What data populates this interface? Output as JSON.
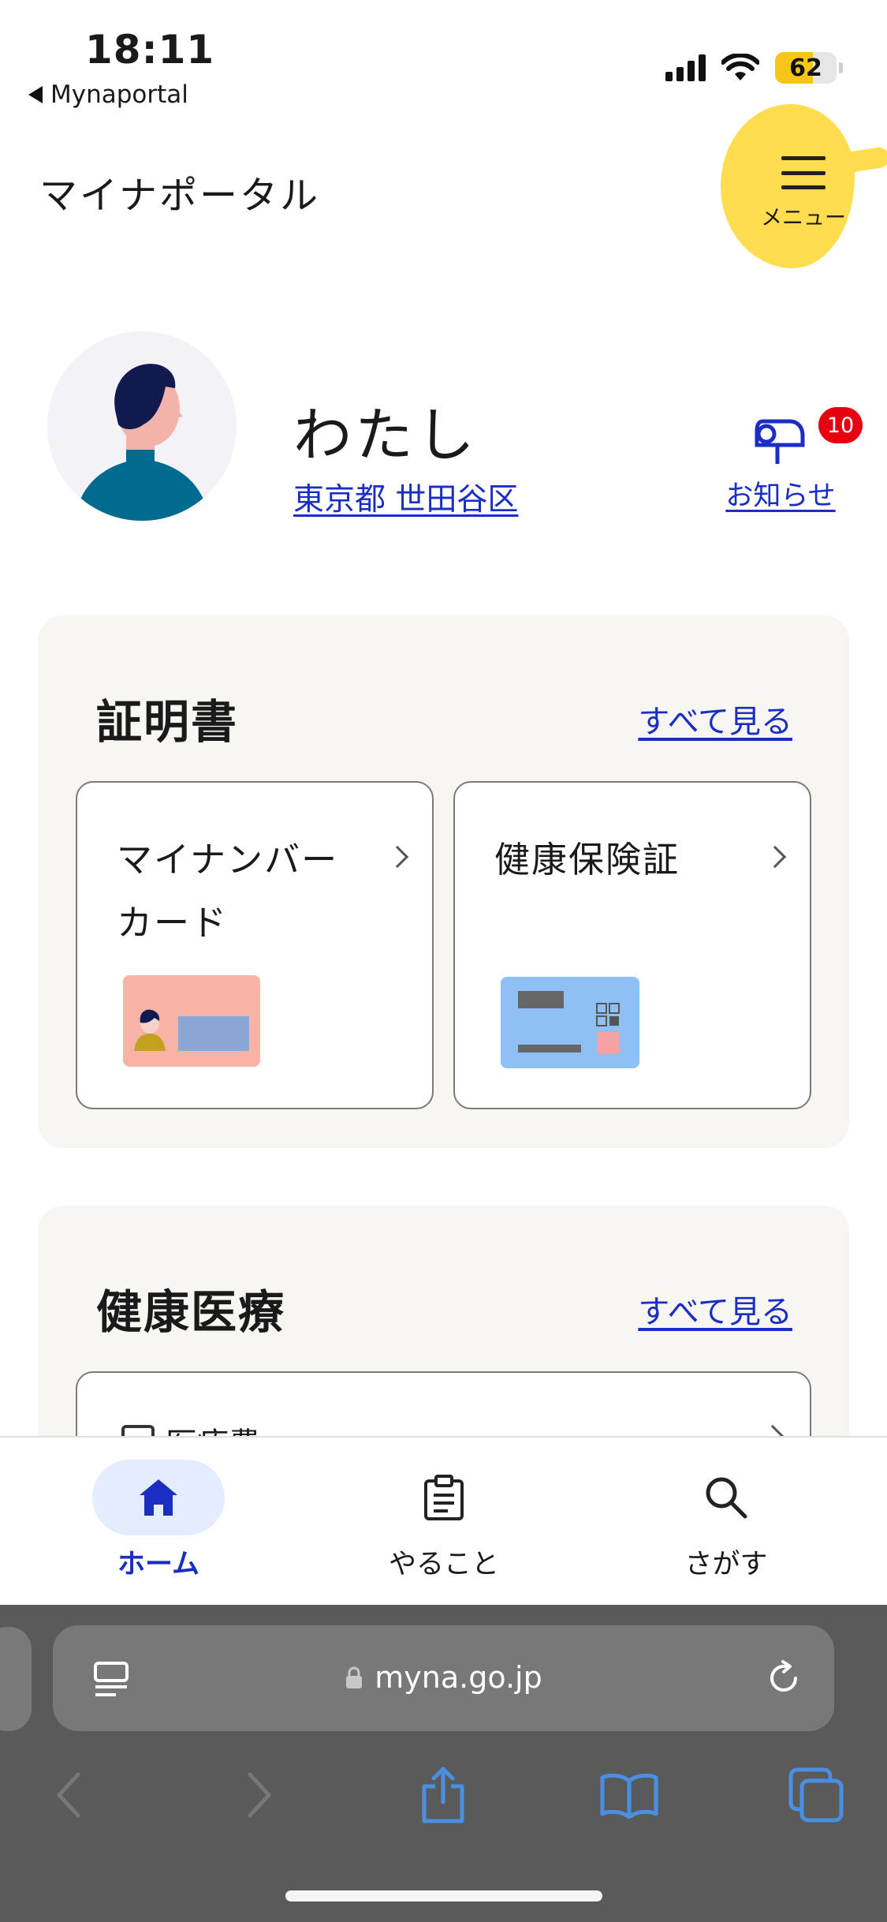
{
  "status_bar": {
    "time": "18:11",
    "back_app": "Mynaportal",
    "battery_level": "62"
  },
  "header": {
    "app_title": "マイナポータル",
    "menu_label": "メニュー"
  },
  "profile": {
    "name": "わたし",
    "location": "東京都 世田谷区",
    "notifications_label": "お知らせ",
    "notifications_count": "10"
  },
  "certificates": {
    "title": "証明書",
    "see_all": "すべて見る",
    "cards": [
      {
        "line1": "マイナンバー",
        "line2": "カード"
      },
      {
        "line1": "健康保険証",
        "line2": ""
      }
    ]
  },
  "healthcare": {
    "title": "健康医療",
    "see_all": "すべて見る",
    "first_item": "医療費"
  },
  "tab_bar": {
    "tabs": [
      {
        "label": "ホーム",
        "icon": "home-icon",
        "active": true
      },
      {
        "label": "やること",
        "icon": "clipboard-icon",
        "active": false
      },
      {
        "label": "さがす",
        "icon": "search-icon",
        "active": false
      }
    ]
  },
  "browser": {
    "url": "myna.go.jp"
  },
  "colors": {
    "accent": "#1a2ec4",
    "highlight": "#ffdd4f",
    "badge": "#e60012",
    "section_bg": "#f7f6f3"
  }
}
